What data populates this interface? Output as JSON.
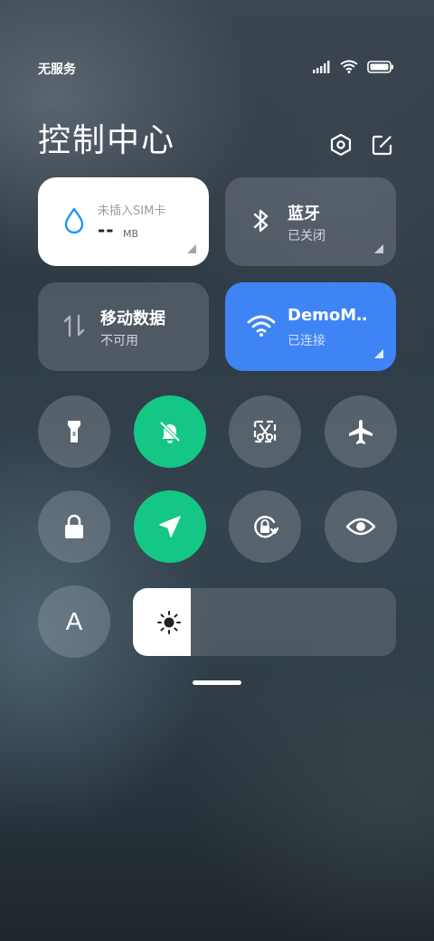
{
  "status_bar": {
    "carrier": "无服务",
    "icons": [
      "signal-icon",
      "wifi-icon",
      "battery-icon"
    ]
  },
  "header": {
    "title": "控制中心",
    "settings_icon": "settings-hexagon-icon",
    "edit_icon": "edit-icon"
  },
  "tiles": {
    "data_usage": {
      "label": "未插入SIM卡",
      "value": "--",
      "unit": "MB",
      "icon": "water-drop-icon"
    },
    "bluetooth": {
      "title": "蓝牙",
      "status": "已关闭",
      "icon": "bluetooth-icon"
    },
    "mobile_data": {
      "title": "移动数据",
      "status": "不可用",
      "icon": "mobile-data-arrows-icon"
    },
    "wifi": {
      "title": "DemoM‥",
      "status": "已连接",
      "icon": "wifi-icon",
      "color": "#3f84f5"
    }
  },
  "toggles": [
    {
      "icon": "flashlight-icon",
      "active": false
    },
    {
      "icon": "mute-bell-icon",
      "active": true
    },
    {
      "icon": "screenshot-icon",
      "active": false
    },
    {
      "icon": "airplane-icon",
      "active": false
    },
    {
      "icon": "lock-icon",
      "active": false
    },
    {
      "icon": "location-icon",
      "active": true
    },
    {
      "icon": "rotation-lock-icon",
      "active": false
    },
    {
      "icon": "eye-icon",
      "active": false
    },
    {
      "icon": "auto-brightness-icon",
      "label": "A",
      "active": false
    }
  ],
  "brightness": {
    "level": 0.22,
    "icon": "sun-icon"
  },
  "colors": {
    "active_green": "#14c784",
    "active_blue": "#3f84f5"
  }
}
